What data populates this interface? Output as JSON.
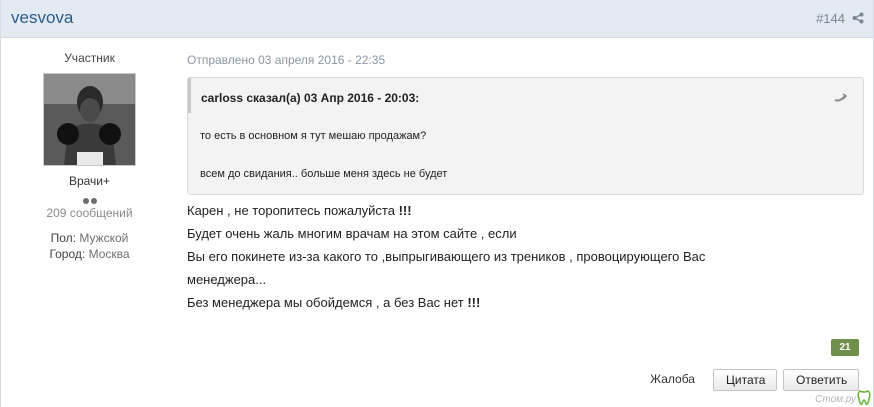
{
  "post": {
    "author": "vesvova",
    "number": "#144",
    "group": "Участник",
    "rank": "Врачи+",
    "post_count": "209 сообщений",
    "fields": [
      {
        "label": "Пол:",
        "value": "Мужской"
      },
      {
        "label": "Город:",
        "value": "Москва"
      }
    ],
    "date": "Отправлено 03 апреля 2016 - 22:35",
    "reputation": "21"
  },
  "quote": {
    "citation": "carloss сказал(а) 03 Апр 2016 - 20:03:",
    "lines": [
      "то есть в основном я тут мешаю продажам?",
      "всем до свидания.. больше меня здесь не будет"
    ]
  },
  "body": {
    "line1_text": "Карен ,  не  торопитесь пожалуйста ",
    "line1_strong": "!!!",
    "line2": "Будет  очень  жаль многим врачам  на этом  сайте ,  если",
    "line3": "Вы  его  покинете  из-за какого то  ,выпрыгивающего  из  треников ,  провоцирующего  Вас",
    "line4": "менеджера...",
    "line5_text": "Без  менеджера  мы  обойдемся  ,  а без  Вас нет  ",
    "line5_strong": "!!!"
  },
  "actions": {
    "report": "Жалоба",
    "quote": "Цитата",
    "reply": "Ответить"
  },
  "watermark": "Стом.ру",
  "icons": {
    "share": "share-icon",
    "quote_back": "quote-back-icon",
    "watermark": "tooth-logo-icon"
  },
  "colors": {
    "header_bg": "#e4eaf1",
    "author_link": "#2a5d8c",
    "reputation_badge": "#6f8f4d"
  }
}
